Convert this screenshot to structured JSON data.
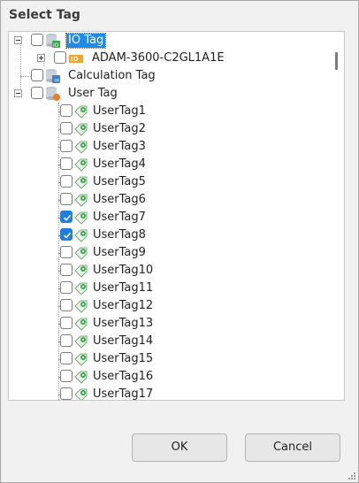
{
  "window": {
    "title": "Select Tag"
  },
  "tree": {
    "root_nodes": [
      {
        "label": "IO Tag",
        "icon": "io-tag-database-icon",
        "expanded": true,
        "selected": true,
        "checked": false
      },
      {
        "label": "ADAM-3600-C2GL1A1E",
        "icon": "io-device-icon",
        "expanded": false,
        "checked": false
      },
      {
        "label": "Calculation Tag",
        "icon": "calculation-tag-icon",
        "checked": false
      },
      {
        "label": "User Tag",
        "icon": "user-tag-database-icon",
        "expanded": true,
        "checked": false
      }
    ],
    "user_tags": [
      {
        "label": "UserTag1",
        "checked": false
      },
      {
        "label": "UserTag2",
        "checked": false
      },
      {
        "label": "UserTag3",
        "checked": false
      },
      {
        "label": "UserTag4",
        "checked": false
      },
      {
        "label": "UserTag5",
        "checked": false
      },
      {
        "label": "UserTag6",
        "checked": false
      },
      {
        "label": "UserTag7",
        "checked": true
      },
      {
        "label": "UserTag8",
        "checked": true
      },
      {
        "label": "UserTag9",
        "checked": false
      },
      {
        "label": "UserTag10",
        "checked": false
      },
      {
        "label": "UserTag11",
        "checked": false
      },
      {
        "label": "UserTag12",
        "checked": false
      },
      {
        "label": "UserTag13",
        "checked": false
      },
      {
        "label": "UserTag14",
        "checked": false
      },
      {
        "label": "UserTag15",
        "checked": false
      },
      {
        "label": "UserTag16",
        "checked": false
      },
      {
        "label": "UserTag17",
        "checked": false
      }
    ],
    "tag_icon": "user-tag-icon"
  },
  "buttons": {
    "ok_label": "OK",
    "cancel_label": "Cancel"
  },
  "colors": {
    "selection": "#1f8ae8",
    "checked": "#1f7ee0",
    "tag_icon_green": "#2fae3e"
  }
}
